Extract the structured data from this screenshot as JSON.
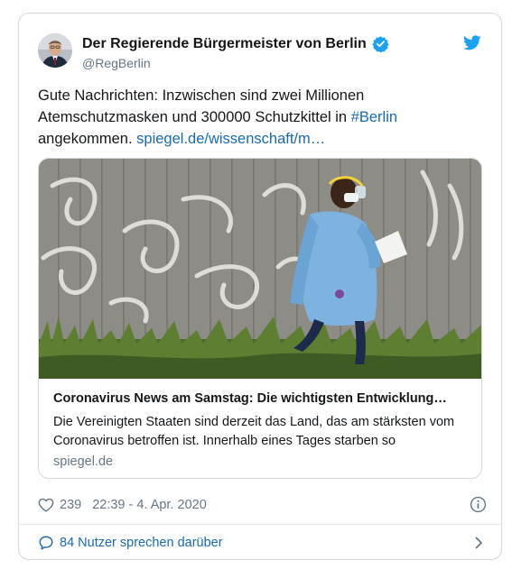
{
  "author": {
    "name": "Der Regierende Bürgermeister von Berlin",
    "handle": "@RegBerlin",
    "verified_icon": "verified-badge-icon",
    "avatar_icon": "avatar"
  },
  "brand": {
    "icon": "twitter-bird-icon",
    "color": "#1da1f2"
  },
  "tweet": {
    "text_line1": "Gute Nachrichten: Inzwischen sind zwei Millionen",
    "text_line2_prefix": "Atemschutzmasken und 300000 Schutzkittel in ",
    "hashtag": "#Berlin",
    "text_line3_prefix": "angekommen. ",
    "url": "spiegel.de/wissenschaft/m…"
  },
  "link_card": {
    "title": "Coronavirus News am Samstag: Die wichtigsten Entwicklung…",
    "description": "Die Vereinigten Staaten sind derzeit das Land, das am stärksten vom Coronavirus betroffen ist. Innerhalb eines Tages starben so",
    "domain": "spiegel.de",
    "image_icon": "article-photo"
  },
  "meta": {
    "likes": "239",
    "timestamp": "22:39 - 4. Apr. 2020",
    "heart_icon": "heart-icon",
    "info_icon": "info-icon"
  },
  "conversation": {
    "label": "84 Nutzer sprechen darüber",
    "bubble_icon": "speech-bubble-icon",
    "chevron_icon": "chevron-right-icon"
  },
  "colors": {
    "link": "#1b6aa8",
    "muted": "#657786",
    "border": "#cfd9de",
    "text": "#14171a"
  }
}
